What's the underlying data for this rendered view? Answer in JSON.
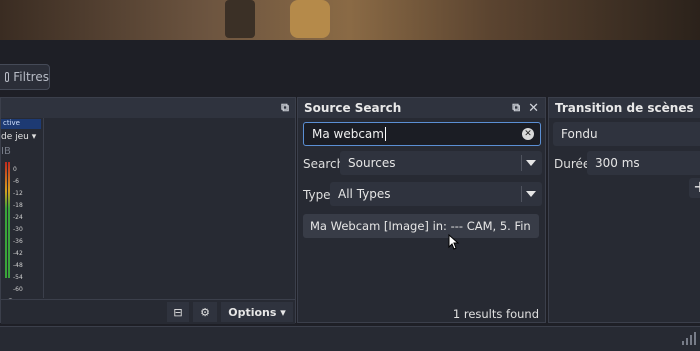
{
  "toolbar": {
    "filters_label": "Filtres"
  },
  "mixer": {
    "active_tag": "ctive",
    "device_label": "de jeu",
    "db_label": "IB",
    "ticks": [
      "0",
      "-6",
      "-12",
      "-18",
      "-24",
      "-30",
      "-36",
      "-42",
      "-48",
      "-54",
      "-60"
    ],
    "options_label": "Options"
  },
  "search_dock": {
    "title": "Source Search",
    "query": "Ma webcam",
    "search_label": "Search:",
    "search_value": "Sources",
    "type_label": "Type:",
    "type_value": "All Types",
    "result_item": "Ma Webcam [Image] in: --- CAM, 5. Fin",
    "results_found": "1 results found"
  },
  "transition_dock": {
    "title": "Transition de scènes",
    "transition_value": "Fondu",
    "duration_label": "Durée",
    "duration_value": "300 ms",
    "add_label": "+"
  }
}
